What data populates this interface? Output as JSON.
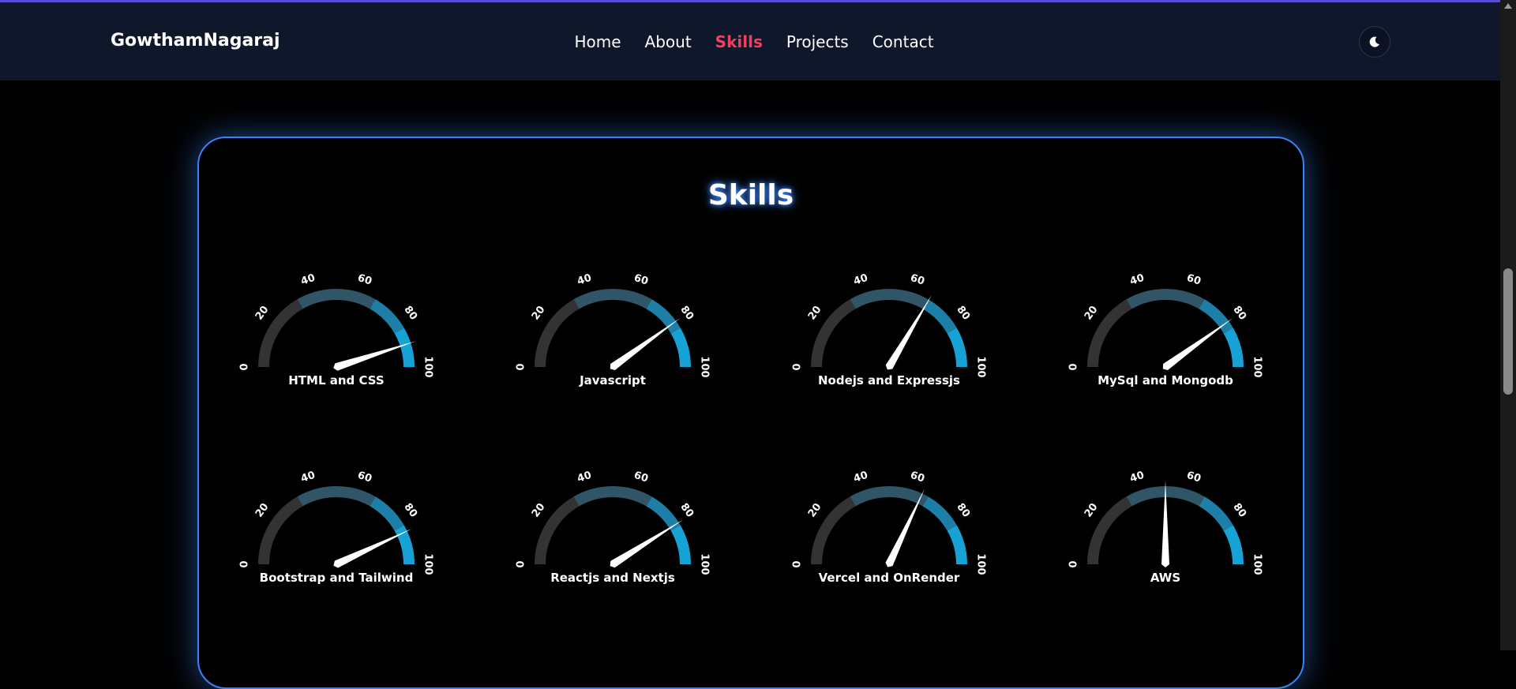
{
  "header": {
    "brand": "GowthamNagaraj",
    "nav": [
      {
        "label": "Home",
        "active": false
      },
      {
        "label": "About",
        "active": false
      },
      {
        "label": "Skills",
        "active": true
      },
      {
        "label": "Projects",
        "active": false
      },
      {
        "label": "Contact",
        "active": false
      }
    ],
    "theme_icon": "moon-icon"
  },
  "skills": {
    "title": "Skills",
    "ticks": [
      "0",
      "20",
      "40",
      "60",
      "80",
      "100"
    ],
    "colors": {
      "low": "#333333",
      "mid": "#2f5566",
      "high": "#1d7fa8",
      "max": "#17a2d6",
      "needle": "#ffffff",
      "accent": "#3b82f6"
    },
    "items": [
      {
        "label": "HTML and CSS",
        "value": 90
      },
      {
        "label": "Javascript",
        "value": 80
      },
      {
        "label": "Nodejs and Expressjs",
        "value": 67
      },
      {
        "label": "MySql and Mongodb",
        "value": 80
      },
      {
        "label": "Bootstrap and Tailwind",
        "value": 86
      },
      {
        "label": "Reactjs and Nextjs",
        "value": 82
      },
      {
        "label": "Vercel and OnRender",
        "value": 64
      },
      {
        "label": "AWS",
        "value": 50
      }
    ]
  }
}
